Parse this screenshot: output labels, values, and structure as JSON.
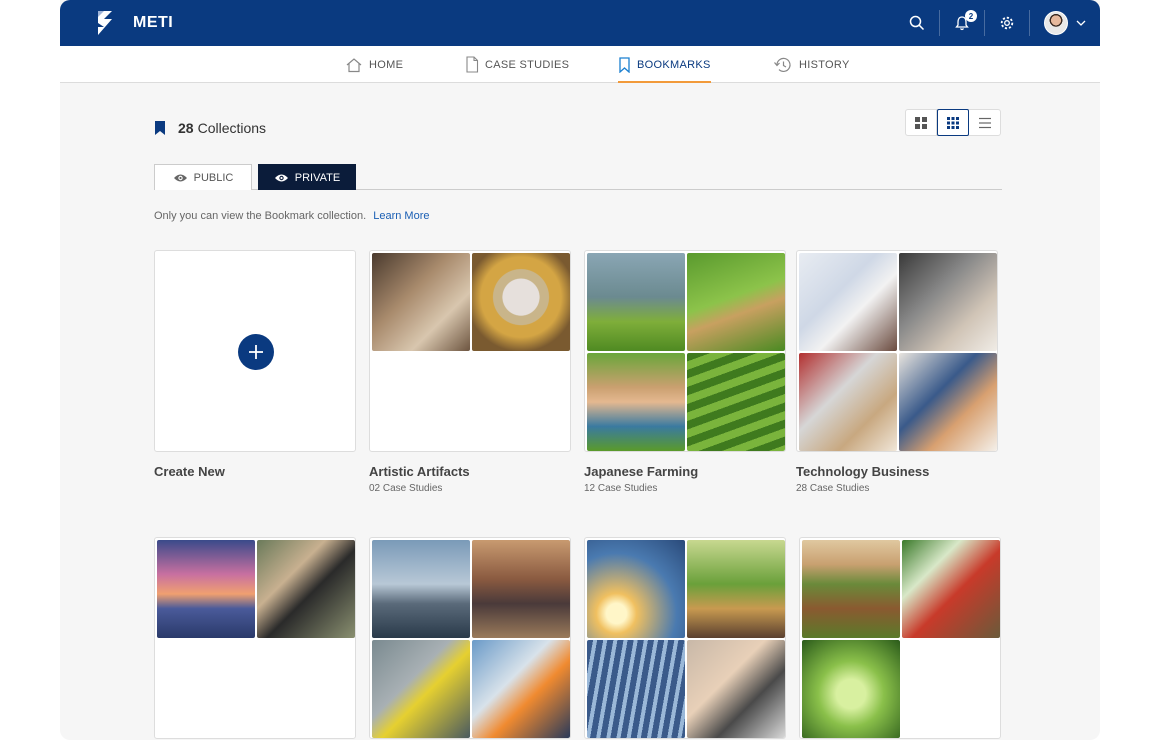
{
  "app": {
    "brand": "METI",
    "notification_count": "2"
  },
  "nav": {
    "items": [
      {
        "label": "HOME"
      },
      {
        "label": "CASE STUDIES"
      },
      {
        "label": "BOOKMARKS"
      },
      {
        "label": "HISTORY"
      }
    ],
    "active": "BOOKMARKS"
  },
  "collections": {
    "count": "28",
    "label": "Collections"
  },
  "tabs": {
    "public": "PUBLIC",
    "private": "PRIVATE",
    "active": "PRIVATE"
  },
  "note": {
    "text": "Only you can view the Bookmark collection.",
    "link": "Learn More"
  },
  "cards": [
    {
      "title": "Create New",
      "sub": ""
    },
    {
      "title": "Artistic Artifacts",
      "sub": "02 Case Studies"
    },
    {
      "title": "Japanese Farming",
      "sub": "12 Case Studies"
    },
    {
      "title": "Technology Business",
      "sub": "28 Case Studies"
    }
  ],
  "colors": {
    "primary": "#0a3a80",
    "accent": "#f29a3a",
    "active_tab": "#0b1c3a",
    "link": "#1a5fb4"
  },
  "icons": [
    "search-icon",
    "bell-icon",
    "gear-icon",
    "chevron-down-icon",
    "home-icon",
    "document-icon",
    "bookmark-icon",
    "history-icon",
    "eye-icon",
    "plus-icon",
    "grid-large-icon",
    "grid-small-icon",
    "list-icon"
  ]
}
